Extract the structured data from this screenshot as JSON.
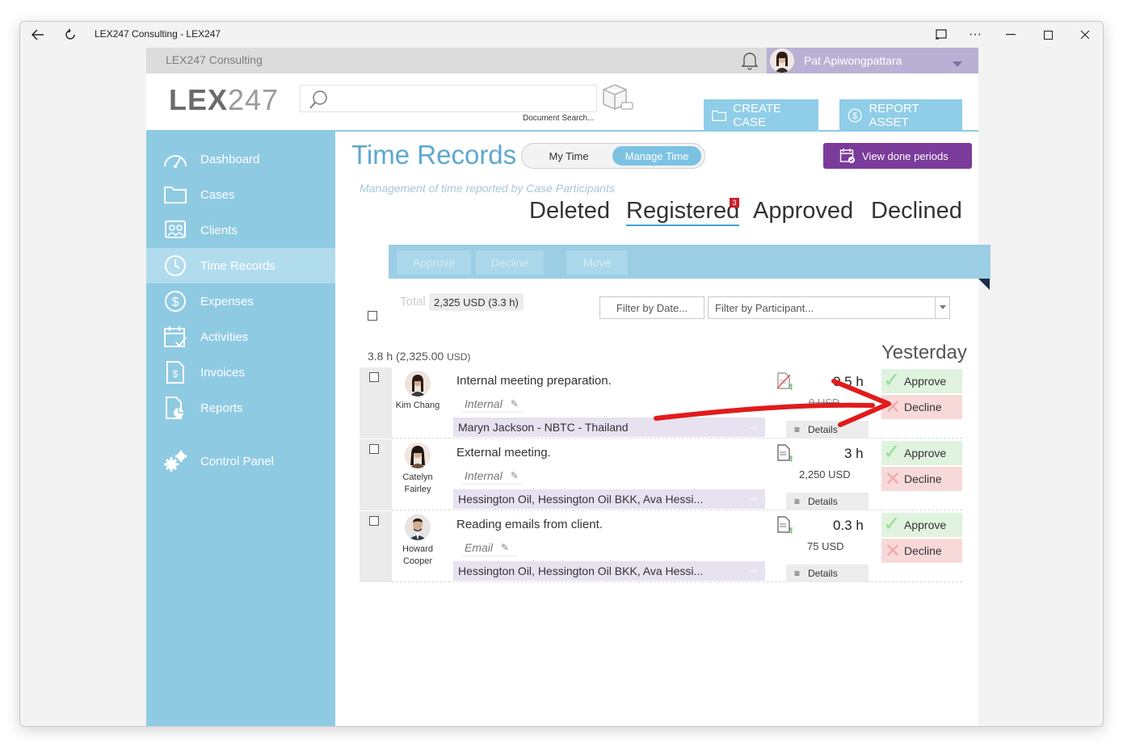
{
  "window": {
    "title": "LEX247 Consulting - LEX247"
  },
  "topbar": {
    "company": "LEX247 Consulting",
    "user_name": "Pat Apiwongpattara"
  },
  "header": {
    "logo_bold": "LEX",
    "logo_light": "247",
    "search_placeholder": "",
    "search_label": "Document Search...",
    "create_case": "CREATE CASE",
    "report_asset": "REPORT ASSET"
  },
  "sidebar": {
    "items": [
      {
        "label": "Dashboard",
        "icon": "gauge-icon"
      },
      {
        "label": "Cases",
        "icon": "folder-icon"
      },
      {
        "label": "Clients",
        "icon": "contacts-icon"
      },
      {
        "label": "Time Records",
        "icon": "clock-icon"
      },
      {
        "label": "Expenses",
        "icon": "dollar-circle-icon"
      },
      {
        "label": "Activities",
        "icon": "calendar-icon"
      },
      {
        "label": "Invoices",
        "icon": "invoice-icon"
      },
      {
        "label": "Reports",
        "icon": "report-icon"
      },
      {
        "label": "Control Panel",
        "icon": "gears-icon"
      }
    ],
    "active": "Time Records"
  },
  "main": {
    "title": "Time Records",
    "toggle": {
      "my_time": "My Time",
      "manage_time": "Manage Time"
    },
    "view_done_periods": "View done periods",
    "subtitle": "Management of time reported by Case Participants",
    "tabs": [
      "Deleted",
      "Registered",
      "Approved",
      "Declined"
    ],
    "active_tab": "Registered",
    "registered_badge": "3",
    "actions": {
      "approve": "Approve",
      "decline": "Decline",
      "move": "Move"
    },
    "total_label": "Total",
    "total_value": "2,325 USD (3.3 h)",
    "filter_date": "Filter by Date...",
    "filter_participant": "Filter by Participant...",
    "group_hours": "3.8 h (2,325.00",
    "group_currency": "USD)",
    "group_day": "Yesterday",
    "records": [
      {
        "person": "Kim Chang",
        "description": "Internal meeting preparation.",
        "tag": "Internal",
        "client": "Maryn Jackson - NBTC - Thailand",
        "hours": "0.5 h",
        "amount": "0 USD",
        "details": "Details",
        "approve": "Approve",
        "decline": "Decline"
      },
      {
        "person": "Catelyn Fairley",
        "description": "External meeting.",
        "tag": "Internal",
        "client": "Hessington Oil, Hessington Oil BKK, Ava Hessi...",
        "hours": "3 h",
        "amount": "2,250 USD",
        "details": "Details",
        "approve": "Approve",
        "decline": "Decline"
      },
      {
        "person": "Howard Cooper",
        "description": "Reading emails from client.",
        "tag": "Email",
        "client": "Hessington Oil, Hessington Oil BKK, Ava Hessi...",
        "hours": "0.3 h",
        "amount": "75 USD",
        "details": "Details",
        "approve": "Approve",
        "decline": "Decline"
      }
    ]
  },
  "colors": {
    "sidebar": "#8fcae3",
    "accent": "#5fa8cf",
    "purple_button": "#7a3b9a",
    "annotation_arrow": "#e11b1b"
  }
}
